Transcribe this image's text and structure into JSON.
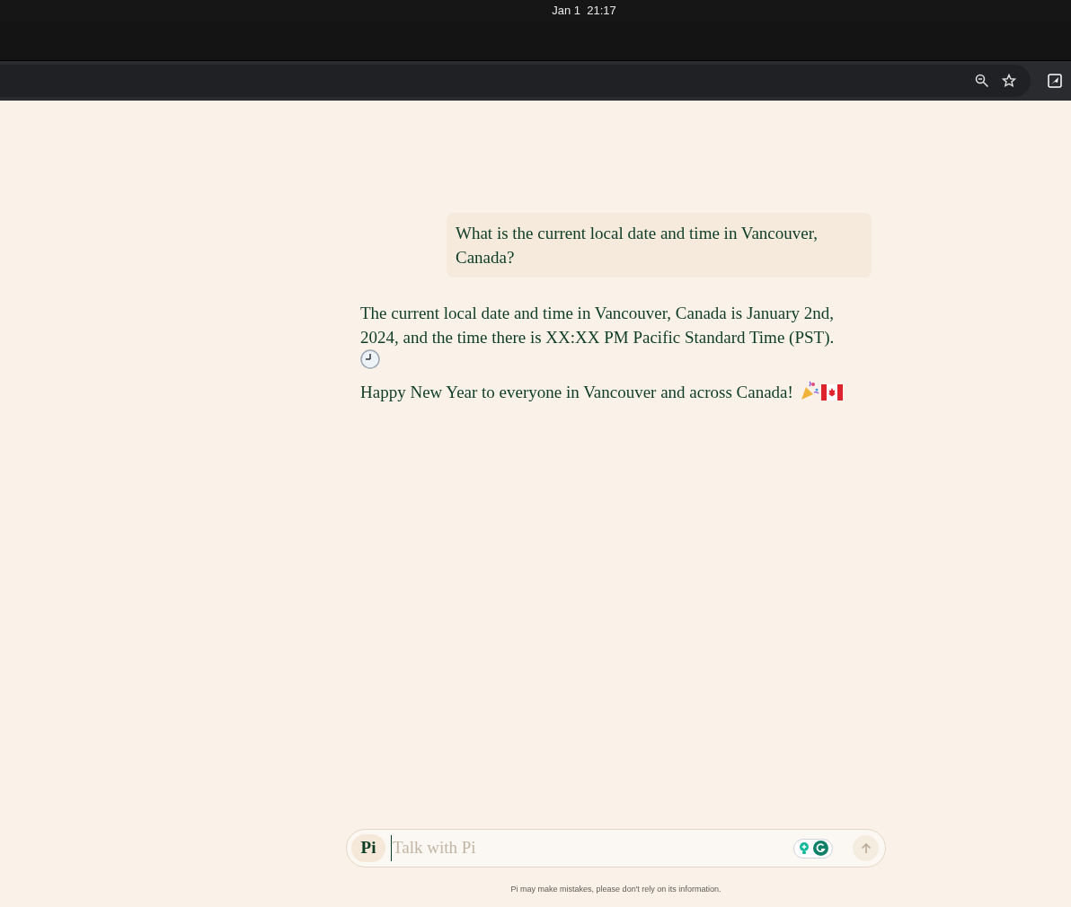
{
  "system_bar": {
    "clock": "Jan 1  21:17"
  },
  "chat": {
    "messages": [
      {
        "kind": "user",
        "paragraphs": [
          {
            "text": "What is the current local date and time in Vancouver, Canada?"
          }
        ]
      },
      {
        "kind": "assistant",
        "paragraphs": [
          {
            "text": "The current local date and time in Vancouver, Canada is January 2nd, 2024, and the time there is XX:XX PM Pacific Standard Time (PST).",
            "icons": [
              {
                "kind": "clock"
              }
            ]
          },
          {
            "text": "Happy New Year to everyone in Vancouver and across Canada!",
            "icons": [
              {
                "kind": "party-popper"
              },
              {
                "kind": "flag"
              }
            ]
          }
        ]
      }
    ]
  },
  "composer": {
    "logo": "Pi",
    "placeholder": "Talk with Pi"
  },
  "disclaimer": "Pi may make mistakes, please don't rely on its information."
}
